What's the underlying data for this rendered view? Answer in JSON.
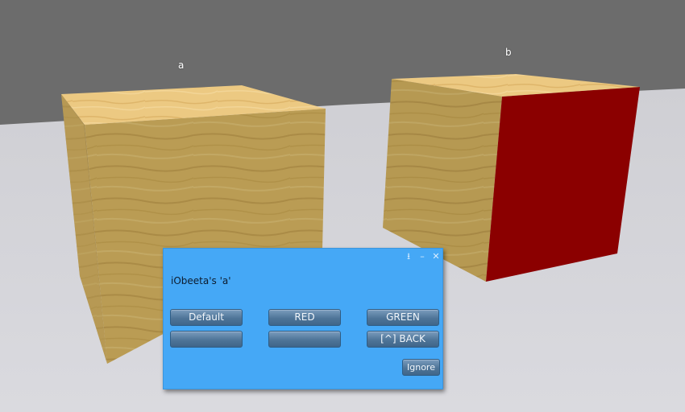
{
  "scene": {
    "objects": [
      {
        "label": "a",
        "icon": "wood-cube-icon"
      },
      {
        "label": "b",
        "icon": "wood-cube-red-face-icon"
      }
    ],
    "colors": {
      "sky": "#6c6c6c",
      "ground": "#d4d4d9",
      "wood": "#c9a95a",
      "red_face": "#8b0000"
    }
  },
  "dialog": {
    "message": "iObeeta's 'a'",
    "controls": [
      "download-icon",
      "minimize-icon",
      "close-icon"
    ],
    "buttons": {
      "default": "Default",
      "red": "RED",
      "green": "GREEN",
      "empty1": "",
      "empty2": "",
      "back": "[^] BACK",
      "ignore": "Ignore"
    },
    "background_color": "#45a8f6"
  }
}
